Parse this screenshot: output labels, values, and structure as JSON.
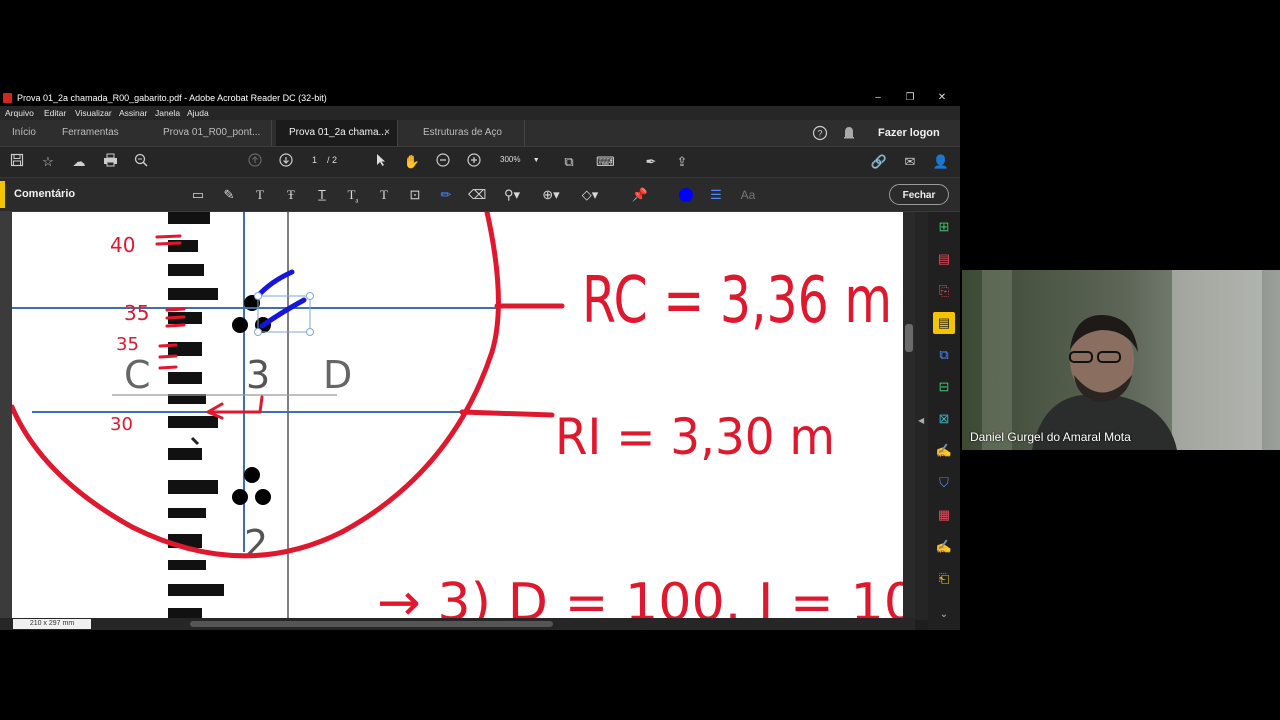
{
  "window": {
    "title": "Prova 01_2a chamada_R00_gabarito.pdf - Adobe Acrobat Reader DC (32-bit)",
    "minimize": "–",
    "restore": "❐",
    "close": "✕"
  },
  "menu": [
    "Arquivo",
    "Editar",
    "Visualizar",
    "Assinar",
    "Janela",
    "Ajuda"
  ],
  "tabs": {
    "home": "Início",
    "tools": "Ferramentas",
    "docs": [
      {
        "label": "Prova 01_R00_pont...",
        "active": false
      },
      {
        "label": "Prova 01_2a chama...",
        "active": true,
        "close": "×"
      },
      {
        "label": "Estruturas de Aço",
        "active": false
      }
    ],
    "help_icon": "help-icon",
    "bell_icon": "bell-icon",
    "login": "Fazer logon"
  },
  "toolbar": {
    "page_current": "1",
    "page_total": "/ 2",
    "zoom": "300%",
    "icons": [
      "save-icon",
      "star-icon",
      "upload-icon",
      "print-icon",
      "search-icon",
      "page-up-icon",
      "page-down-icon",
      "select-icon",
      "hand-icon",
      "zoom-out-icon",
      "zoom-in-icon",
      "page-view-icon",
      "keyboard-icon",
      "sign-icon",
      "share-icon",
      "link-icon",
      "mail-icon",
      "person-add-icon"
    ]
  },
  "comment": {
    "label": "Comentário",
    "text_tool": "Aa",
    "close_button": "Fechar",
    "accent": "#f5c400",
    "color_dot": "#0000ff"
  },
  "document": {
    "handwriting_color": "#e0182d",
    "overlay_color": "#1515dd",
    "rod_labels": {
      "left": "C",
      "middle": "3",
      "right": "D",
      "lower": "2"
    },
    "staff_marks": [
      "40",
      "35",
      "35",
      "30"
    ],
    "rc": "RC = 3,36 m",
    "ri": "RI = 3,30 m",
    "bottom_partial": "→ 3) D = 100. I = 10"
  },
  "statusbar": {
    "page_size": "210 x 297 mm"
  },
  "video": {
    "participant_name": "Daniel Gurgel do Amaral Mota"
  }
}
